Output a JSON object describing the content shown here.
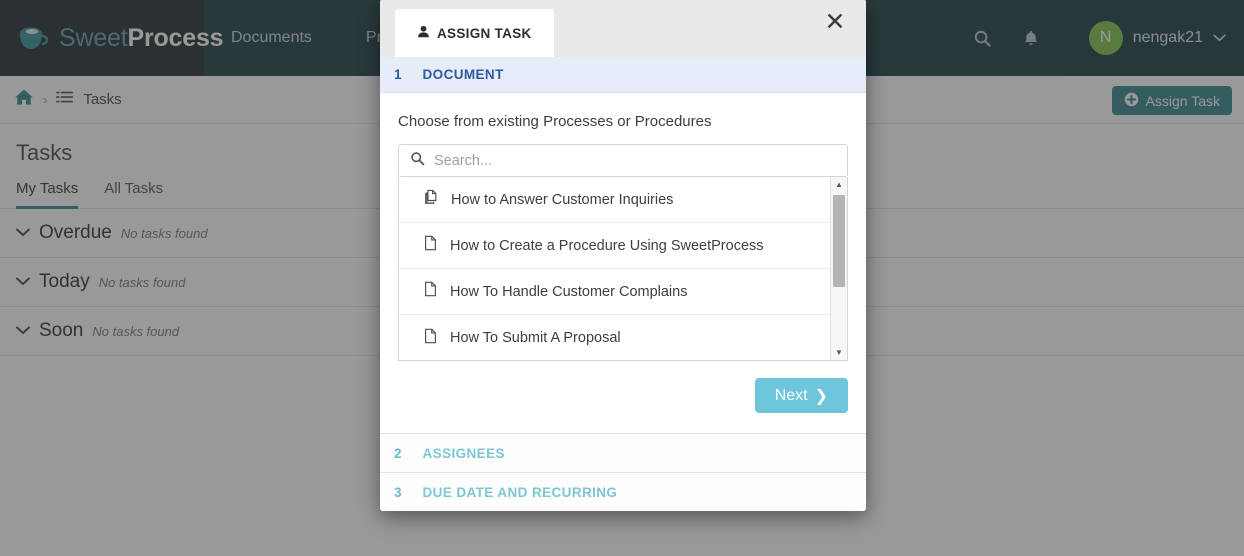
{
  "topnav": {
    "brand": {
      "light": "Sweet",
      "bold": "Process",
      "logo_icon": "coffee-cup-icon"
    },
    "items": [
      {
        "label": "Documents"
      },
      {
        "label": "Pro"
      }
    ],
    "search_icon": "search-icon",
    "bell_icon": "bell-icon",
    "user": {
      "initial": "N",
      "name": "nengak21",
      "chevron": "chevron-down-icon"
    }
  },
  "breadcrumb": {
    "home_icon": "home-icon",
    "separator": "›",
    "list_icon": "list-icon",
    "current": "Tasks"
  },
  "assign_button": {
    "label": "Assign Task",
    "icon": "plus-circle-icon"
  },
  "main": {
    "title": "Tasks",
    "tabs": [
      {
        "label": "My Tasks",
        "active": true
      },
      {
        "label": "All Tasks",
        "active": false
      }
    ],
    "groups": [
      {
        "caret": "chevron-down-icon",
        "name": "Overdue",
        "empty": "No tasks found"
      },
      {
        "caret": "chevron-down-icon",
        "name": "Today",
        "empty": "No tasks found"
      },
      {
        "caret": "chevron-down-icon",
        "name": "Soon",
        "empty": "No tasks found"
      }
    ]
  },
  "modal": {
    "tab_label": "ASSIGN TASK",
    "tab_icon": "person-icon",
    "close_icon": "close-icon",
    "close_glyph": "✕",
    "steps": [
      {
        "num": "1",
        "label": "DOCUMENT",
        "expanded": true
      },
      {
        "num": "2",
        "label": "ASSIGNEES",
        "expanded": false
      },
      {
        "num": "3",
        "label": "DUE DATE AND RECURRING",
        "expanded": false
      }
    ],
    "document_step": {
      "instruction": "Choose from existing Processes or Procedures",
      "search": {
        "value": "",
        "placeholder": "Search...",
        "icon": "search-icon"
      },
      "documents": [
        {
          "title": "How to Answer Customer Inquiries",
          "icon": "copy-pages-icon"
        },
        {
          "title": "How to Create a Procedure Using SweetProcess",
          "icon": "page-icon"
        },
        {
          "title": "How To Handle Customer Complains",
          "icon": "page-icon"
        },
        {
          "title": "How To Submit A Proposal",
          "icon": "page-icon"
        }
      ],
      "scrollbar": {
        "up_glyph": "▲",
        "down_glyph": "▼"
      },
      "next_button": {
        "label": "Next",
        "chevron": "❯"
      }
    }
  },
  "colors": {
    "nav_dark": "#1b2428",
    "nav_teal": "#14383d",
    "accent_teal": "#2f7f87",
    "next_blue": "#6ec6dc",
    "step_blue": "#2d5a9e",
    "step_teal": "#7ec6d4",
    "avatar_green": "#7ac043"
  }
}
